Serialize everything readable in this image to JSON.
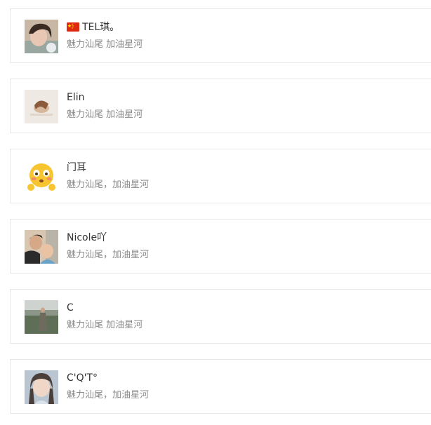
{
  "contacts": [
    {
      "name": "TEL琪。",
      "flag": "china-flag-icon",
      "subtitle": "魅力汕尾 加油星河",
      "avatar": "woman-selfie-avatar"
    },
    {
      "name": "Elin",
      "subtitle": "魅力汕尾 加油星河",
      "avatar": "lying-figure-avatar"
    },
    {
      "name": "门耳",
      "subtitle": "魅力汕尾，加油星河",
      "avatar": "flushed-emoji-avatar"
    },
    {
      "name": "Nicole吖",
      "subtitle": "魅力汕尾，加油星河",
      "avatar": "mother-child-avatar"
    },
    {
      "name": "C",
      "subtitle": "魅力汕尾 加油星河",
      "avatar": "field-person-avatar"
    },
    {
      "name": "C'Q'T°",
      "subtitle": "魅力汕尾，加油星河",
      "avatar": "girl-portrait-avatar"
    }
  ]
}
